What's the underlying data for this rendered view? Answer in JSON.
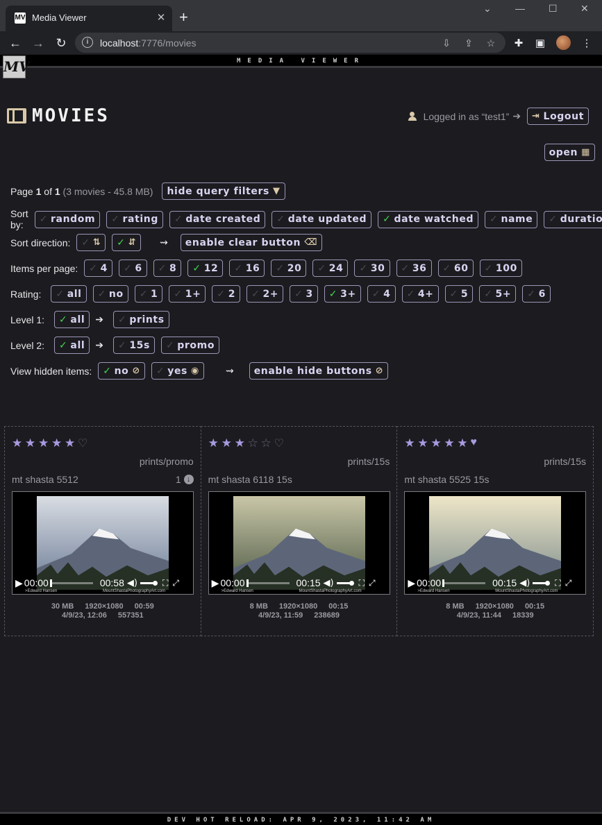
{
  "browser": {
    "tab_title": "Media Viewer",
    "url_host": "localhost",
    "url_rest": ":7776/movies"
  },
  "banner": "MEDIA VIEWER",
  "logo_text": "MV",
  "page": {
    "title": "MOVIES",
    "logged_in_text": "Logged in as “test1”",
    "arrow": "➔",
    "logout_label": "Logout",
    "open_label": "open"
  },
  "filters": {
    "page_prefix": "Page ",
    "page_num": "1",
    "page_of": " of ",
    "page_total": "1",
    "page_summary": "(3 movies - 45.8 MB)",
    "hide_filters_label": "hide query filters",
    "sort_by_label": "Sort by:",
    "sort_by": [
      {
        "label": "random",
        "checked": false
      },
      {
        "label": "rating",
        "checked": false
      },
      {
        "label": "date created",
        "checked": false
      },
      {
        "label": "date updated",
        "checked": false
      },
      {
        "label": "date watched",
        "checked": true
      },
      {
        "label": "name",
        "checked": false
      },
      {
        "label": "duration",
        "checked": false
      }
    ],
    "sort_dir_label": "Sort direction:",
    "enable_clear_label": "enable clear button",
    "items_per_page_label": "Items per page:",
    "items_per_page": [
      {
        "label": "4",
        "checked": false
      },
      {
        "label": "6",
        "checked": false
      },
      {
        "label": "8",
        "checked": false
      },
      {
        "label": "12",
        "checked": true
      },
      {
        "label": "16",
        "checked": false
      },
      {
        "label": "20",
        "checked": false
      },
      {
        "label": "24",
        "checked": false
      },
      {
        "label": "30",
        "checked": false
      },
      {
        "label": "36",
        "checked": false
      },
      {
        "label": "60",
        "checked": false
      },
      {
        "label": "100",
        "checked": false
      }
    ],
    "rating_label": "Rating:",
    "rating": [
      {
        "label": "all",
        "checked": false
      },
      {
        "label": "no",
        "checked": false
      },
      {
        "label": "1",
        "checked": false
      },
      {
        "label": "1+",
        "checked": false
      },
      {
        "label": "2",
        "checked": false
      },
      {
        "label": "2+",
        "checked": false
      },
      {
        "label": "3",
        "checked": false
      },
      {
        "label": "3+",
        "checked": true
      },
      {
        "label": "4",
        "checked": false
      },
      {
        "label": "4+",
        "checked": false
      },
      {
        "label": "5",
        "checked": false
      },
      {
        "label": "5+",
        "checked": false
      },
      {
        "label": "6",
        "checked": false
      }
    ],
    "level1_label": "Level 1:",
    "level1_all": "all",
    "level1_next": "prints",
    "level2_label": "Level 2:",
    "level2_all": "all",
    "level2_opts": [
      "15s",
      "promo"
    ],
    "hidden_label": "View hidden items:",
    "hidden_no": "no",
    "hidden_yes": "yes",
    "enable_hide_label": "enable hide buttons"
  },
  "cards": [
    {
      "stars": 5,
      "heart": false,
      "path": "prints/promo",
      "title": "mt shasta 5512",
      "count": "1",
      "time_cur": "00:00",
      "time_total": "00:58",
      "credit_left": ">Edward Hansen",
      "credit_right": "MountShastaPhotographyArt.com",
      "size": "30 MB",
      "resolution": "1920×1080",
      "duration": "00:59",
      "date": "4/9/23, 12:06",
      "views": "557351",
      "accent": "#a99ae0"
    },
    {
      "stars": 3,
      "heart": false,
      "path": "prints/15s",
      "title": "mt shasta 6118 15s",
      "count": "",
      "time_cur": "00:00",
      "time_total": "00:15",
      "credit_left": ">Edward Hansen",
      "credit_right": "MountShastaPhotographyArt.com",
      "size": "8 MB",
      "resolution": "1920×1080",
      "duration": "00:15",
      "date": "4/9/23, 11:59",
      "views": "238689",
      "accent": "#a99ae0"
    },
    {
      "stars": 5,
      "heart": true,
      "path": "prints/15s",
      "title": "mt shasta 5525 15s",
      "count": "",
      "time_cur": "00:00",
      "time_total": "00:15",
      "credit_left": ">Edward Hansen",
      "credit_right": "MountShastaPhotographyArt.com",
      "size": "8 MB",
      "resolution": "1920×1080",
      "duration": "00:15",
      "date": "4/9/23, 11:44",
      "views": "18339",
      "accent": "#a99ae0"
    }
  ],
  "footer": "DEV HOT RELOAD: APR 9, 2023, 11:42 AM",
  "colors": {
    "background": "#1c1b20",
    "accent": "#a99ae0",
    "check_on": "#3fd94f",
    "icon_tan": "#d9c9a8"
  }
}
